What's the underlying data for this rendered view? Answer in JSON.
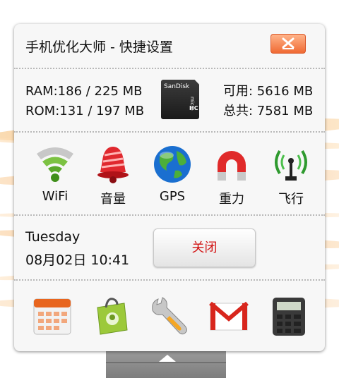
{
  "title": "手机优化大师 - 快捷设置",
  "memory": {
    "ram": "RAM:186 / 225 MB",
    "rom": "ROM:131 / 197 MB",
    "available": "可用: 5616 MB",
    "total": "总共: 7581 MB"
  },
  "sdcard": {
    "brand": "SanDisk",
    "micro": "micro",
    "hc": "HC"
  },
  "toggles": [
    {
      "label": "WiFi",
      "icon": "wifi-icon"
    },
    {
      "label": "音量",
      "icon": "bell-icon"
    },
    {
      "label": "GPS",
      "icon": "globe-icon"
    },
    {
      "label": "重力",
      "icon": "magnet-icon"
    },
    {
      "label": "飞行",
      "icon": "antenna-icon"
    }
  ],
  "clock": {
    "day": "Tuesday",
    "datetime": "08月02日 10:41"
  },
  "off_button": "关闭",
  "apps": [
    {
      "icon": "calendar-icon"
    },
    {
      "icon": "market-bag-icon"
    },
    {
      "icon": "wrench-icon"
    },
    {
      "icon": "gmail-icon"
    },
    {
      "icon": "calculator-icon"
    }
  ],
  "colors": {
    "accent": "#f06a33",
    "off_text": "#d21414",
    "panel": "#f7f7f7"
  }
}
